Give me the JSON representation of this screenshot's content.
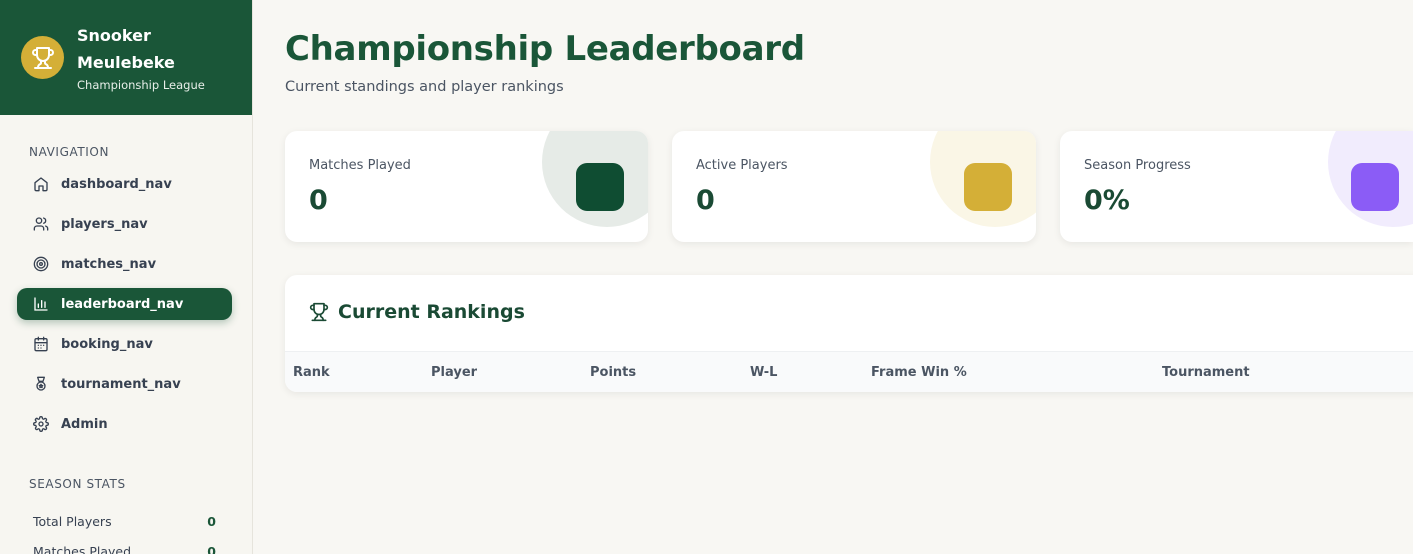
{
  "brand": {
    "title": "Snooker Meulebeke",
    "subtitle": "Championship League",
    "logo_icon": "trophy-icon",
    "color": "#1a5638",
    "accent": "#d4af37"
  },
  "navigation": {
    "title": "NAVIGATION",
    "items": [
      {
        "label": "dashboard_nav",
        "icon": "home-icon"
      },
      {
        "label": "players_nav",
        "icon": "users-icon"
      },
      {
        "label": "matches_nav",
        "icon": "target-icon"
      },
      {
        "label": "leaderboard_nav",
        "icon": "bar-chart-icon",
        "active": true
      },
      {
        "label": "booking_nav",
        "icon": "calendar-icon"
      },
      {
        "label": "tournament_nav",
        "icon": "award-icon"
      },
      {
        "label": "Admin",
        "icon": "gear-icon"
      }
    ]
  },
  "season_stats": {
    "title": "SEASON STATS",
    "rows": [
      {
        "label": "Total Players",
        "value": "0"
      },
      {
        "label": "Matches Played",
        "value": "0"
      }
    ]
  },
  "header": {
    "title": "Championship Leaderboard",
    "subtitle": "Current standings and player rankings"
  },
  "cards": [
    {
      "label": "Matches Played",
      "value": "0",
      "color": "#0f4d32",
      "bubble": "#e6ebe7"
    },
    {
      "label": "Active Players",
      "value": "0",
      "color": "#d4af37",
      "bubble": "#faf6e6"
    },
    {
      "label": "Season Progress",
      "value": "0%",
      "color": "#8b5cf6",
      "bubble": "#f1ecfd"
    }
  ],
  "rankings": {
    "title": "Current Rankings",
    "columns": [
      "Rank",
      "Player",
      "Points",
      "W-L",
      "Frame Win %",
      "Tournament"
    ]
  }
}
